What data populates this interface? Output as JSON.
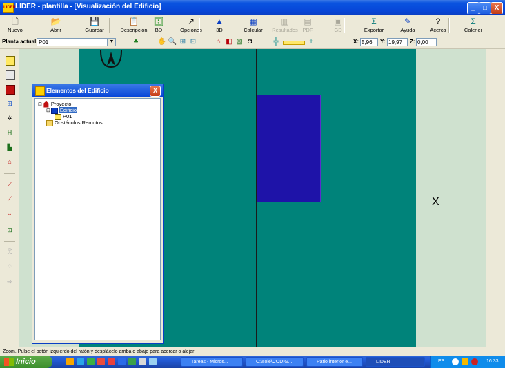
{
  "window": {
    "title": "LIDER - plantilla - [Visualización del Edificio]",
    "app_icon_text": "LIDER",
    "minimize": "_",
    "maximize": "□",
    "close": "X"
  },
  "toolbar": {
    "buttons": [
      {
        "label": "Nuevo",
        "icon": "new-file-icon",
        "glyph": "🗋",
        "enabled": true
      },
      {
        "label": "Abrir",
        "icon": "open-folder-icon",
        "glyph": "📂",
        "enabled": true
      },
      {
        "label": "Guardar",
        "icon": "save-disk-icon",
        "glyph": "💾",
        "enabled": true
      },
      {
        "label": "Descripción",
        "icon": "description-icon",
        "glyph": "📋",
        "enabled": true
      },
      {
        "label": "BD",
        "icon": "database-icon",
        "glyph": "🗄",
        "enabled": true
      },
      {
        "label": "Opciones",
        "icon": "options-arrow-icon",
        "glyph": "↗",
        "enabled": true
      },
      {
        "label": "3D",
        "icon": "3d-view-icon",
        "glyph": "▲",
        "enabled": true
      },
      {
        "label": "Calcular",
        "icon": "calculator-icon",
        "glyph": "▦",
        "enabled": true
      },
      {
        "label": "Resultados",
        "icon": "results-chart-icon",
        "glyph": "▥",
        "enabled": false
      },
      {
        "label": "PDF",
        "icon": "pdf-icon",
        "glyph": "▤",
        "enabled": false
      },
      {
        "label": "GD",
        "icon": "gd-icon",
        "glyph": "▣",
        "enabled": false
      },
      {
        "label": "Exportar",
        "icon": "export-sigma-icon",
        "glyph": "Σ",
        "enabled": true
      },
      {
        "label": "Ayuda",
        "icon": "help-book-icon",
        "glyph": "✎",
        "enabled": true
      },
      {
        "label": "Acerca",
        "icon": "about-question-icon",
        "glyph": "?",
        "enabled": true
      },
      {
        "label": "Calener",
        "icon": "calener-sigma-icon",
        "glyph": "Σ",
        "enabled": true
      }
    ]
  },
  "plantbar": {
    "label": "Planta actual",
    "value": "P01",
    "x_label": "X:",
    "x_value": "5,96",
    "y_label": "Y:",
    "y_value": "19,97",
    "z_label": "Z:",
    "z_value": "0,00"
  },
  "canvas": {
    "axis_label": "X"
  },
  "panel": {
    "title": "Elementos del Edificio",
    "close": "X",
    "tree": [
      {
        "label": "Proyecto",
        "level": 0,
        "icon": "project-house-icon",
        "selected": false
      },
      {
        "label": "Edificio",
        "level": 1,
        "icon": "building-icon",
        "selected": true
      },
      {
        "label": "P01",
        "level": 2,
        "icon": "floor-plan-icon",
        "selected": false
      },
      {
        "label": "Obstáculos Remotos",
        "level": 1,
        "icon": "folder-icon",
        "selected": false
      }
    ]
  },
  "statusbar": {
    "text": "Zoom. Pulse el botón izquierdo del ratón y desplácelo arriba o abajo para acercar o alejar"
  },
  "taskbar": {
    "start_label": "Inicio",
    "tasks": [
      {
        "label": "Tareas - Micros...",
        "active": false
      },
      {
        "label": "C:\\sole\\CODIG...",
        "active": false
      },
      {
        "label": "Patio interior e...",
        "active": false
      },
      {
        "label": "LIDER",
        "active": true
      }
    ],
    "tray_lang": "ES",
    "clock": "16:33"
  },
  "colors": {
    "canvas_bg": "#cfe1cf",
    "teal_area": "#00837a",
    "blue_block": "#1e13a8",
    "titlebar": "#0746d8"
  }
}
